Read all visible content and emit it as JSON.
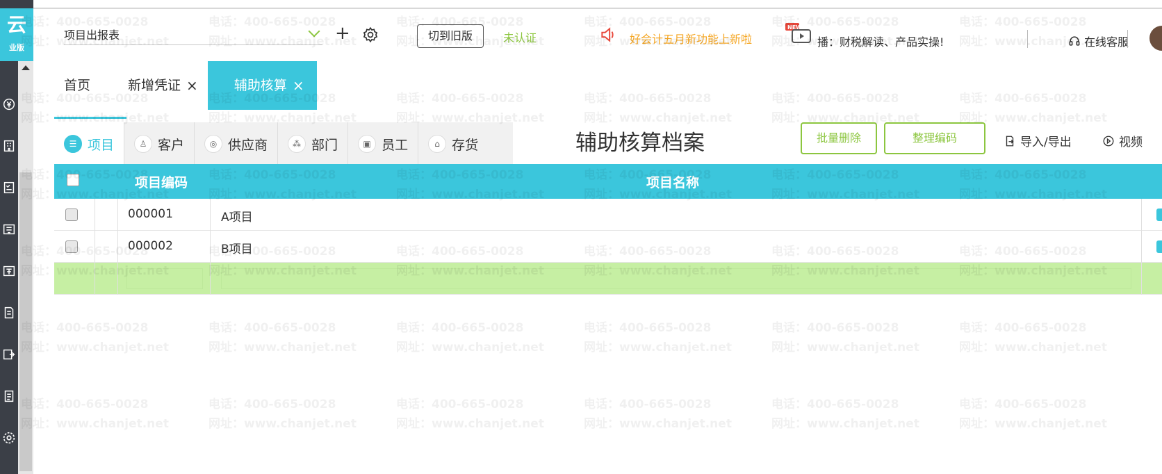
{
  "sidebar": {
    "logo_glyph": "云",
    "edition": "业版",
    "icons": [
      "yuan-ledger-icon",
      "building-icon",
      "checklist-icon",
      "invoice-icon",
      "tax-icon",
      "report-icon",
      "export-icon",
      "document-icon",
      "settings-icon"
    ]
  },
  "topbar": {
    "search_value": "项目出报表",
    "old_version_label": "切到旧版",
    "unverified_label": "未认证",
    "promo_text": "好会计五月新功能上新啦",
    "new_badge": "NEW",
    "broadcast_text": "播：财税解读、产品实操!",
    "service_label": "在线客服"
  },
  "tabs": [
    {
      "label": "首页",
      "closable": false
    },
    {
      "label": "新增凭证",
      "closable": true
    },
    {
      "label": "辅助核算",
      "closable": true,
      "active": true
    }
  ],
  "categories": [
    {
      "label": "项目",
      "active": true
    },
    {
      "label": "客户"
    },
    {
      "label": "供应商"
    },
    {
      "label": "部门"
    },
    {
      "label": "员工"
    },
    {
      "label": "存货"
    }
  ],
  "page": {
    "title": "辅助核算档案",
    "batch_delete": "批量删除",
    "tidy_code": "整理编码",
    "import_export": "导入/导出",
    "video": "视频"
  },
  "table": {
    "headers": {
      "code": "项目编码",
      "name": "项目名称"
    },
    "rows": [
      {
        "code": "000001",
        "name": "A项目"
      },
      {
        "code": "000002",
        "name": "B项目"
      }
    ]
  },
  "watermark": {
    "phone": "电话：400-665-0028",
    "site": "网址：www.chanjet.net"
  },
  "colors": {
    "accent": "#3bc6dc",
    "green": "#8cc63f",
    "orange": "#f5a623",
    "edit_row": "#c6efa3"
  }
}
